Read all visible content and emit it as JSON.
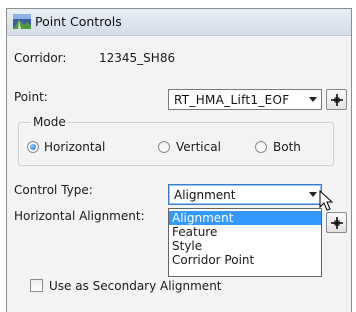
{
  "window": {
    "title": "Point Controls"
  },
  "corridor": {
    "label": "Corridor:",
    "value": "12345_SH86"
  },
  "point": {
    "label": "Point:",
    "value": "RT_HMA_Lift1_EOF"
  },
  "mode": {
    "label": "Mode",
    "options": [
      {
        "label": "Horizontal",
        "selected": true
      },
      {
        "label": "Vertical",
        "selected": false
      },
      {
        "label": "Both",
        "selected": false
      }
    ]
  },
  "control_type": {
    "label": "Control Type:",
    "value": "Alignment",
    "options": [
      "Alignment",
      "Feature",
      "Style",
      "Corridor Point"
    ]
  },
  "horizontal_alignment": {
    "label": "Horizontal Alignment:"
  },
  "secondary": {
    "label": "Use as Secondary Alignment",
    "checked": false
  },
  "colors": {
    "selection": "#3399ff",
    "combo_border_active": "#3a7bd5"
  }
}
